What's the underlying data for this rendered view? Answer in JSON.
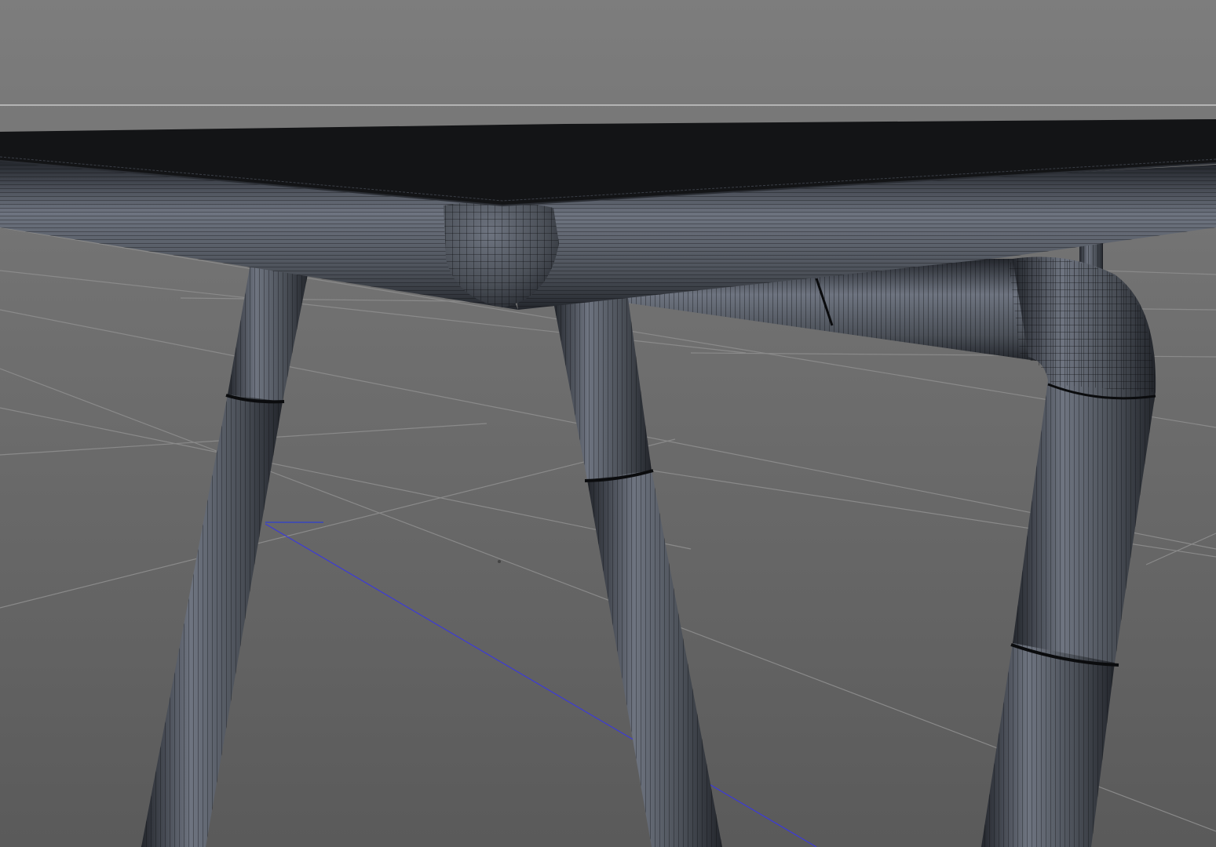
{
  "viewport": {
    "background_top": "#7d7d7d",
    "background_bottom": "#5a5a5a",
    "horizon_line_color": "#b4b4b4",
    "grid_color": "#8a8a8a",
    "z_axis_color": "#3c3ad8",
    "y_axis_color": "#2f3fd0"
  },
  "model": {
    "tabletop_color": "#131416",
    "frame_color": "#4b5058",
    "frame_highlight": "#6e7480",
    "frame_shadow": "#23262c",
    "wire_color": "#0b0c0e"
  }
}
